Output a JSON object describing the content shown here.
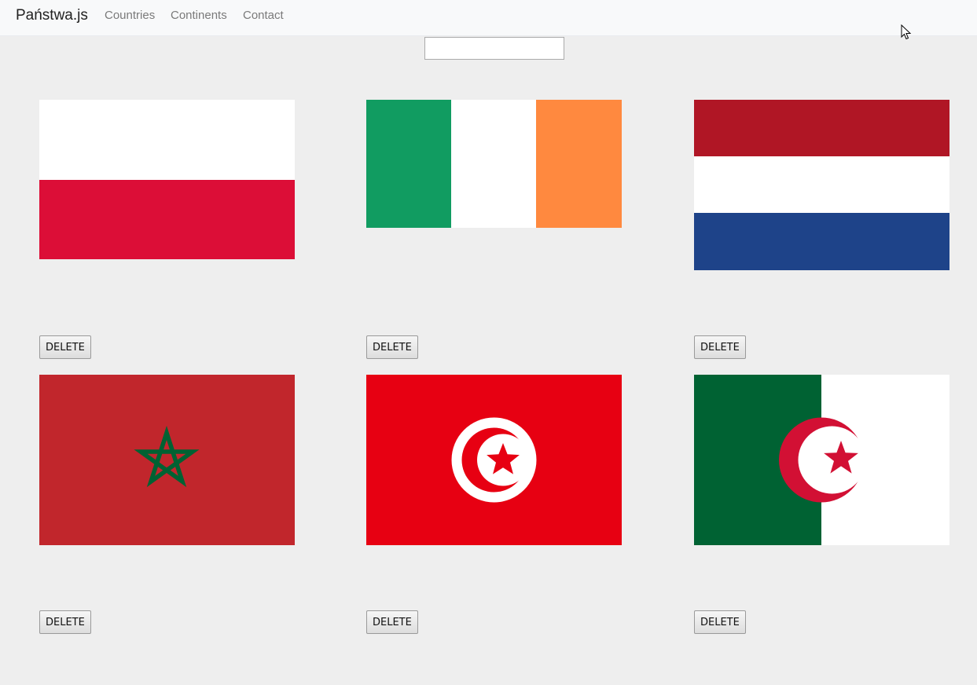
{
  "navbar": {
    "brand": "Państwa.js",
    "links": [
      "Countries",
      "Continents",
      "Contact"
    ]
  },
  "search": {
    "value": "",
    "placeholder": ""
  },
  "countries": [
    {
      "flag": "poland-flag",
      "delete_label": "DELETE"
    },
    {
      "flag": "ireland-flag",
      "delete_label": "DELETE"
    },
    {
      "flag": "netherlands-flag",
      "delete_label": "DELETE"
    },
    {
      "flag": "morocco-flag",
      "delete_label": "DELETE"
    },
    {
      "flag": "tunisia-flag",
      "delete_label": "DELETE"
    },
    {
      "flag": "algeria-flag",
      "delete_label": "DELETE"
    }
  ],
  "colors": {
    "navbar_bg": "#f8f9fa",
    "page_bg": "#eeeeee",
    "poland_red": "#dc0e37",
    "ireland_green": "#119c61",
    "ireland_orange": "#ff893f",
    "netherlands_red": "#b01625",
    "netherlands_blue": "#1e4389",
    "morocco_red": "#c1262c",
    "morocco_green": "#006233",
    "tunisia_red": "#e70012",
    "algeria_green": "#006233",
    "algeria_red": "#d21034"
  }
}
